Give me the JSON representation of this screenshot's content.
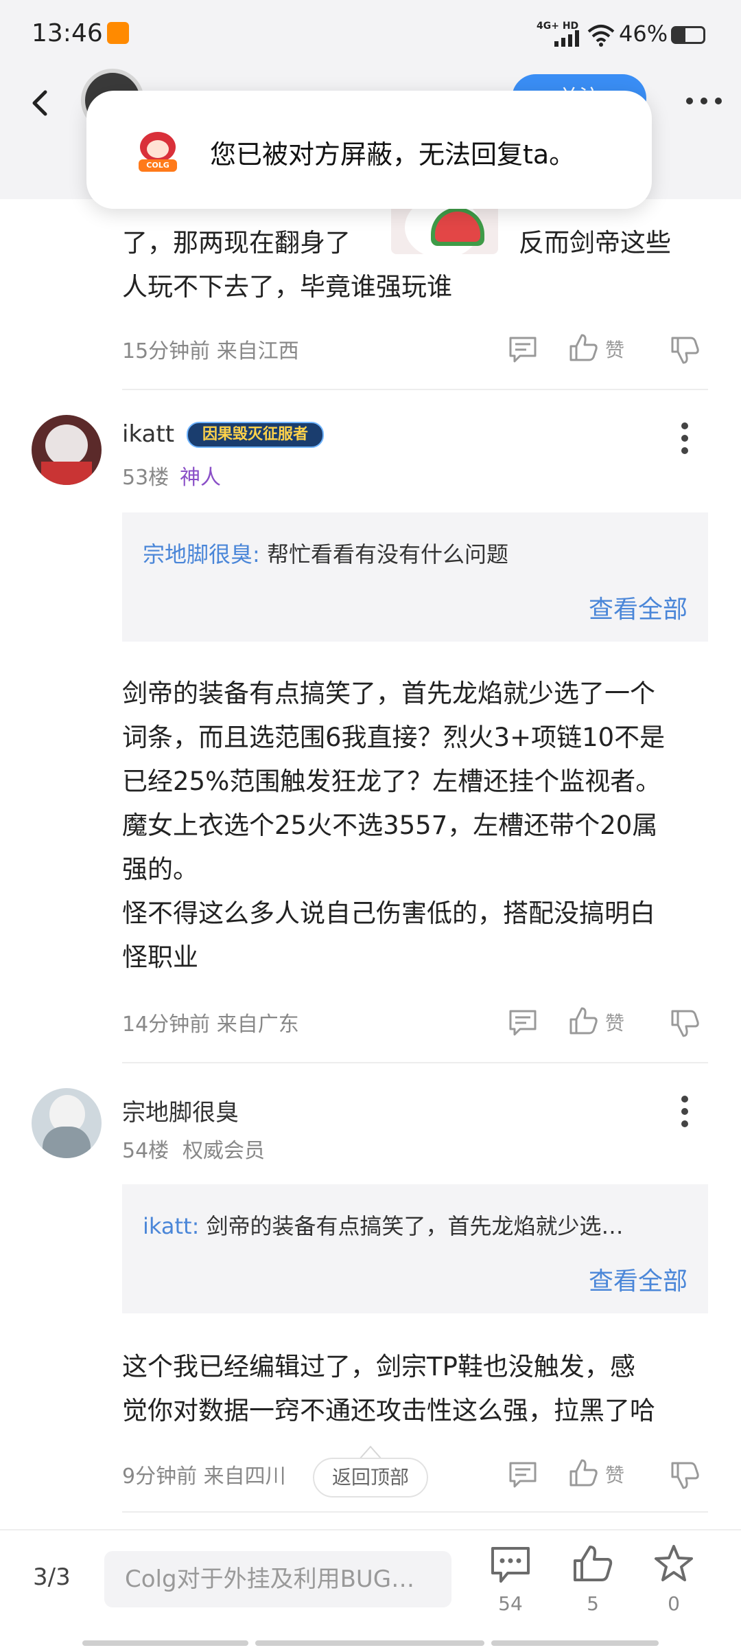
{
  "status_bar": {
    "time": "13:46",
    "network": "4G+ HD",
    "battery": "46%"
  },
  "header": {
    "follow_label": "关注"
  },
  "toast": {
    "message": "您已被对方屏蔽，无法回复ta。",
    "app_icon": "colg-app-icon"
  },
  "posts": [
    {
      "text_lines": [
        "了，那两现在翻身了",
        "人玩不下去了，毕竟谁强玩谁"
      ],
      "text_line1_tail": "反而剑帝这些",
      "meta": "15分钟前 来自江西",
      "like_label": "赞"
    },
    {
      "username": "ikatt",
      "badge": "因果毁灭征服者",
      "floor": "53楼",
      "title": "神人",
      "quote": {
        "author": "宗地脚很臭:",
        "text": "帮忙看看有没有什么问题",
        "view_all": "查看全部"
      },
      "text_lines": [
        "剑帝的装备有点搞笑了，首先龙焰就少选了一个",
        "词条，而且选范围6我直接？烈火3+项链10不是",
        "已经25%范围触发狂龙了？左槽还挂个监视者。",
        "魔女上衣选个25火不选3557，左槽还带个20属",
        "强的。",
        "怪不得这么多人说自己伤害低的，搭配没搞明白",
        "怪职业"
      ],
      "meta": "14分钟前 来自广东",
      "like_label": "赞"
    },
    {
      "username": "宗地脚很臭",
      "floor": "54楼",
      "title": "权威会员",
      "quote": {
        "author": "ikatt:",
        "text": "剑帝的装备有点搞笑了，首先龙焰就少选…",
        "view_all": "查看全部"
      },
      "text_lines": [
        "这个我已经编辑过了，剑宗TP鞋也没触发，感",
        "觉你对数据一窍不通还攻击性这么强，拉黑了哈"
      ],
      "meta": "9分钟前 来自四川",
      "like_label": "赞"
    }
  ],
  "back_to_top": "返回顶部",
  "bottom_bar": {
    "page": "3/3",
    "input_placeholder": "Colg对于外挂及利用BUG…",
    "comments": "54",
    "likes": "5",
    "favorites": "0"
  },
  "colors": {
    "accent": "#3a8ef5",
    "link": "#4a86d8",
    "title_purple": "#8a4fc7"
  }
}
